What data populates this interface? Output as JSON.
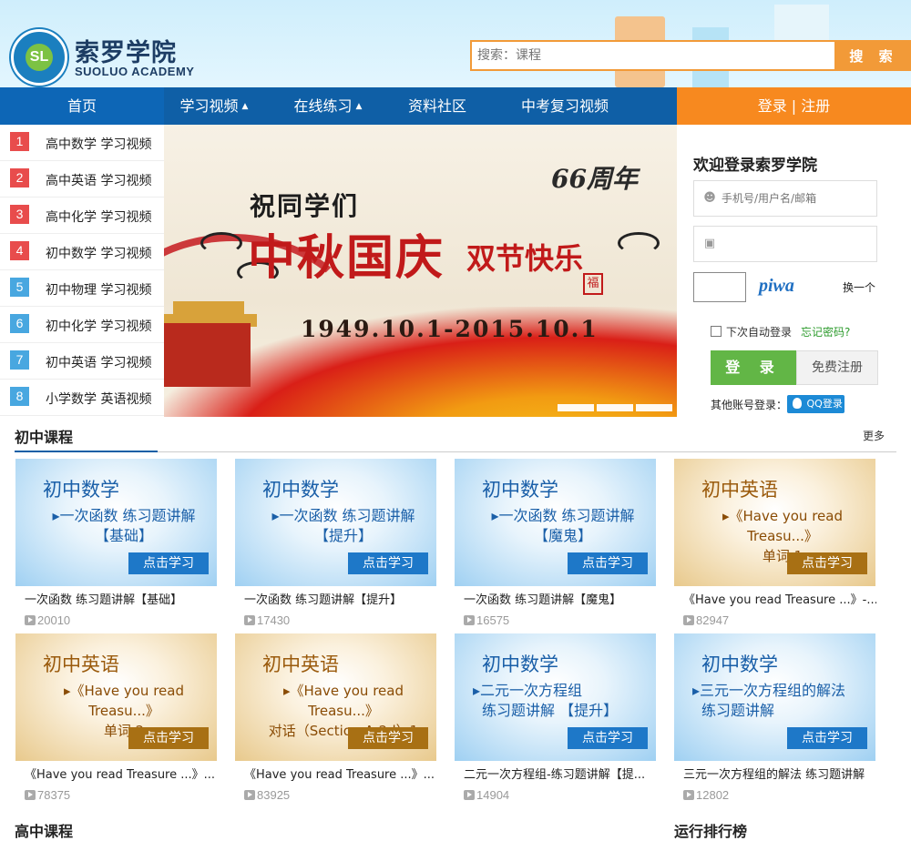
{
  "brand": {
    "logo_mark": "SL",
    "name_cn": "索罗学院",
    "name_en": "SUOLUO ACADEMY"
  },
  "search": {
    "placeholder": "搜索：课程",
    "button": "搜 索"
  },
  "nav": {
    "items": [
      {
        "label": "首页",
        "dropdown": false
      },
      {
        "label": "学习视频",
        "dropdown": true
      },
      {
        "label": "在线练习",
        "dropdown": true
      },
      {
        "label": "资料社区",
        "dropdown": false
      },
      {
        "label": "中考复习视频",
        "dropdown": false
      }
    ],
    "dropdown_glyph": "▲",
    "login": "登录",
    "separator": "|",
    "register": "注册"
  },
  "sidebar": {
    "items": [
      {
        "num": "1",
        "label": "高中数学 学习视频",
        "color": "#e84c4c"
      },
      {
        "num": "2",
        "label": "高中英语 学习视频",
        "color": "#e84c4c"
      },
      {
        "num": "3",
        "label": "高中化学 学习视频",
        "color": "#e84c4c"
      },
      {
        "num": "4",
        "label": "初中数学 学习视频",
        "color": "#e84c4c"
      },
      {
        "num": "5",
        "label": "初中物理 学习视频",
        "color": "#48a7e0"
      },
      {
        "num": "6",
        "label": "初中化学 学习视频",
        "color": "#48a7e0"
      },
      {
        "num": "7",
        "label": "初中英语 学习视频",
        "color": "#48a7e0"
      },
      {
        "num": "8",
        "label": "小学数学 英语视频",
        "color": "#48a7e0"
      }
    ]
  },
  "banner": {
    "line1": "祝同学们",
    "line2a": "中秋国庆",
    "line2b": "双节快乐",
    "anniversary": "66周年",
    "date": "1949.10.1-2015.10.1",
    "stamp": "福",
    "slides": 3
  },
  "login": {
    "title": "欢迎登录索罗学院",
    "username_placeholder": "手机号/用户名/邮箱",
    "password_placeholder": "",
    "captcha_text": "piwa",
    "captcha_refresh": "换一个",
    "remember": "下次自动登录",
    "forgot": "忘记密码?",
    "login_button": "登 录",
    "register_button": "免费注册",
    "other_label": "其他账号登录：",
    "qq_label": "QQ登录"
  },
  "section": {
    "title": "初中课程",
    "more": "更多"
  },
  "courses": [
    {
      "theme": "blue",
      "head": "初中数学",
      "sub1": "一次函数 练习题讲解",
      "sub2": "【基础】",
      "btn": "点击学习",
      "title": "一次函数 练习题讲解【基础】",
      "views": "20010"
    },
    {
      "theme": "blue",
      "head": "初中数学",
      "sub1": "一次函数 练习题讲解",
      "sub2": "【提升】",
      "btn": "点击学习",
      "title": "一次函数 练习题讲解【提升】",
      "views": "17430"
    },
    {
      "theme": "blue",
      "head": "初中数学",
      "sub1": "一次函数 练习题讲解",
      "sub2": "【魔鬼】",
      "btn": "点击学习",
      "title": "一次函数 练习题讲解【魔鬼】",
      "views": "16575"
    },
    {
      "theme": "gold",
      "head": "初中英语",
      "sub1": "《Have you read Treasu...》",
      "sub2": "单词 1",
      "btn": "点击学习",
      "title": "《Have you read Treasure ...》-...",
      "views": "82947"
    },
    {
      "theme": "gold",
      "head": "初中英语",
      "sub1": "《Have you read Treasu...》",
      "sub2": "单词 2",
      "btn": "点击学习",
      "title": "《Have you read Treasure ...》...",
      "views": "78375"
    },
    {
      "theme": "gold",
      "head": "初中英语",
      "sub1": "《Have you read Treasu...》",
      "sub2": "对话（Section A-2d）1",
      "btn": "点击学习",
      "title": "《Have you read Treasure ...》...",
      "views": "83925"
    },
    {
      "theme": "blue",
      "head": "初中数学",
      "sub1": "二元一次方程组",
      "sub2": "练习题讲解 【提升】",
      "btn": "点击学习",
      "title": "二元一次方程组-练习题讲解【提...",
      "views": "14904"
    },
    {
      "theme": "blue",
      "head": "初中数学",
      "sub1": "三元一次方程组的解法",
      "sub2": "练习题讲解",
      "btn": "点击学习",
      "title": "三元一次方程组的解法 练习题讲解",
      "views": "12802"
    }
  ],
  "footer_peek": {
    "left": "高中课程",
    "right": "运行排行榜"
  }
}
